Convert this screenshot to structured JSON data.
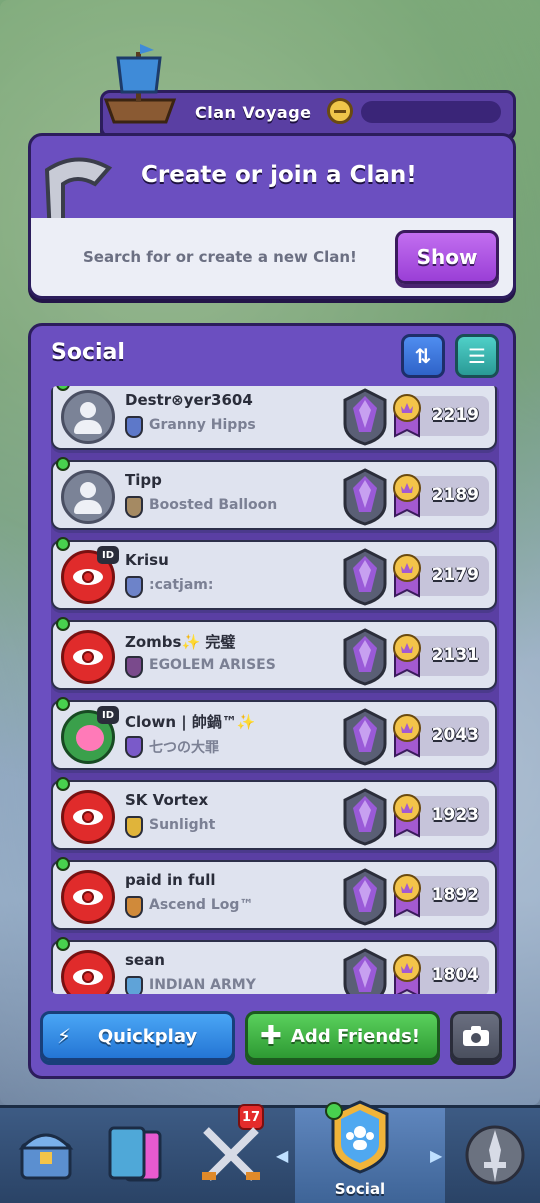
{
  "voyage": {
    "label": "Clan Voyage"
  },
  "clan_card": {
    "title": "Create or join a Clan!",
    "search_text": "Search for or create a new Clan!",
    "show_label": "Show"
  },
  "social": {
    "title": "Social",
    "sort_icon": "sort-arrows-icon",
    "filter_icon": "filter-sliders-icon",
    "friends": [
      {
        "name": "Destr⊗yer3604",
        "clan": "Granny Hipps",
        "trophies": "2219",
        "avatar": "grey",
        "badge_color": "#5d78c9",
        "id_tag": ""
      },
      {
        "name": "Tipp",
        "clan": "Boosted Balloon",
        "trophies": "2189",
        "avatar": "grey",
        "badge_color": "#a58a63",
        "id_tag": ""
      },
      {
        "name": "Krisu",
        "clan": ":catjam:",
        "trophies": "2179",
        "avatar": "red",
        "badge_color": "#6d83c9",
        "id_tag": "ID"
      },
      {
        "name": "Zombs✨ 完璧",
        "clan": "EGOLEM ARISES",
        "trophies": "2131",
        "avatar": "red",
        "badge_color": "#7a4a8c",
        "id_tag": ""
      },
      {
        "name": "Clown | 帥鍋™✨",
        "clan": "七つの大罪",
        "trophies": "2043",
        "avatar": "clown",
        "badge_color": "#7a5ac9",
        "id_tag": "ID"
      },
      {
        "name": "SK Vortex",
        "clan": "Sunlight",
        "trophies": "1923",
        "avatar": "red",
        "badge_color": "#e0b43a",
        "id_tag": ""
      },
      {
        "name": "paid in full",
        "clan": "Ascend Log™",
        "trophies": "1892",
        "avatar": "red",
        "badge_color": "#d08a3a",
        "id_tag": ""
      },
      {
        "name": "sean",
        "clan": "INDIAN ARMY",
        "trophies": "1804",
        "avatar": "red",
        "badge_color": "#5fa3d8",
        "id_tag": ""
      }
    ]
  },
  "actions": {
    "quickplay": "Quickplay",
    "add_friends": "Add Friends!",
    "camera_icon": "camera-icon"
  },
  "nav": {
    "items": [
      "chest-icon",
      "cards-icon",
      "battle-icon",
      "social-icon",
      "clan-wars-icon"
    ],
    "active_label": "Social",
    "cards_badge": "17"
  }
}
